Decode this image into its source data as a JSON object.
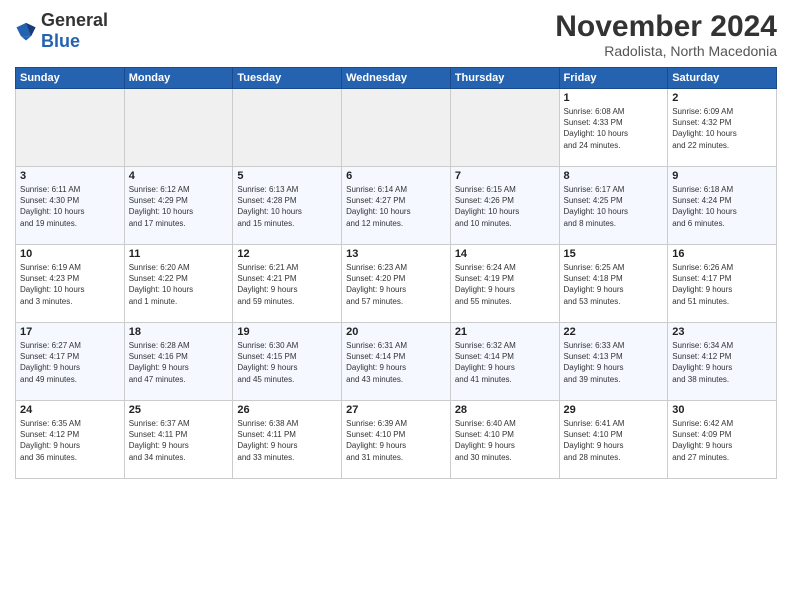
{
  "logo": {
    "general": "General",
    "blue": "Blue"
  },
  "title": "November 2024",
  "subtitle": "Radolista, North Macedonia",
  "headers": [
    "Sunday",
    "Monday",
    "Tuesday",
    "Wednesday",
    "Thursday",
    "Friday",
    "Saturday"
  ],
  "weeks": [
    [
      {
        "day": "",
        "info": ""
      },
      {
        "day": "",
        "info": ""
      },
      {
        "day": "",
        "info": ""
      },
      {
        "day": "",
        "info": ""
      },
      {
        "day": "",
        "info": ""
      },
      {
        "day": "1",
        "info": "Sunrise: 6:08 AM\nSunset: 4:33 PM\nDaylight: 10 hours\nand 24 minutes."
      },
      {
        "day": "2",
        "info": "Sunrise: 6:09 AM\nSunset: 4:32 PM\nDaylight: 10 hours\nand 22 minutes."
      }
    ],
    [
      {
        "day": "3",
        "info": "Sunrise: 6:11 AM\nSunset: 4:30 PM\nDaylight: 10 hours\nand 19 minutes."
      },
      {
        "day": "4",
        "info": "Sunrise: 6:12 AM\nSunset: 4:29 PM\nDaylight: 10 hours\nand 17 minutes."
      },
      {
        "day": "5",
        "info": "Sunrise: 6:13 AM\nSunset: 4:28 PM\nDaylight: 10 hours\nand 15 minutes."
      },
      {
        "day": "6",
        "info": "Sunrise: 6:14 AM\nSunset: 4:27 PM\nDaylight: 10 hours\nand 12 minutes."
      },
      {
        "day": "7",
        "info": "Sunrise: 6:15 AM\nSunset: 4:26 PM\nDaylight: 10 hours\nand 10 minutes."
      },
      {
        "day": "8",
        "info": "Sunrise: 6:17 AM\nSunset: 4:25 PM\nDaylight: 10 hours\nand 8 minutes."
      },
      {
        "day": "9",
        "info": "Sunrise: 6:18 AM\nSunset: 4:24 PM\nDaylight: 10 hours\nand 6 minutes."
      }
    ],
    [
      {
        "day": "10",
        "info": "Sunrise: 6:19 AM\nSunset: 4:23 PM\nDaylight: 10 hours\nand 3 minutes."
      },
      {
        "day": "11",
        "info": "Sunrise: 6:20 AM\nSunset: 4:22 PM\nDaylight: 10 hours\nand 1 minute."
      },
      {
        "day": "12",
        "info": "Sunrise: 6:21 AM\nSunset: 4:21 PM\nDaylight: 9 hours\nand 59 minutes."
      },
      {
        "day": "13",
        "info": "Sunrise: 6:23 AM\nSunset: 4:20 PM\nDaylight: 9 hours\nand 57 minutes."
      },
      {
        "day": "14",
        "info": "Sunrise: 6:24 AM\nSunset: 4:19 PM\nDaylight: 9 hours\nand 55 minutes."
      },
      {
        "day": "15",
        "info": "Sunrise: 6:25 AM\nSunset: 4:18 PM\nDaylight: 9 hours\nand 53 minutes."
      },
      {
        "day": "16",
        "info": "Sunrise: 6:26 AM\nSunset: 4:17 PM\nDaylight: 9 hours\nand 51 minutes."
      }
    ],
    [
      {
        "day": "17",
        "info": "Sunrise: 6:27 AM\nSunset: 4:17 PM\nDaylight: 9 hours\nand 49 minutes."
      },
      {
        "day": "18",
        "info": "Sunrise: 6:28 AM\nSunset: 4:16 PM\nDaylight: 9 hours\nand 47 minutes."
      },
      {
        "day": "19",
        "info": "Sunrise: 6:30 AM\nSunset: 4:15 PM\nDaylight: 9 hours\nand 45 minutes."
      },
      {
        "day": "20",
        "info": "Sunrise: 6:31 AM\nSunset: 4:14 PM\nDaylight: 9 hours\nand 43 minutes."
      },
      {
        "day": "21",
        "info": "Sunrise: 6:32 AM\nSunset: 4:14 PM\nDaylight: 9 hours\nand 41 minutes."
      },
      {
        "day": "22",
        "info": "Sunrise: 6:33 AM\nSunset: 4:13 PM\nDaylight: 9 hours\nand 39 minutes."
      },
      {
        "day": "23",
        "info": "Sunrise: 6:34 AM\nSunset: 4:12 PM\nDaylight: 9 hours\nand 38 minutes."
      }
    ],
    [
      {
        "day": "24",
        "info": "Sunrise: 6:35 AM\nSunset: 4:12 PM\nDaylight: 9 hours\nand 36 minutes."
      },
      {
        "day": "25",
        "info": "Sunrise: 6:37 AM\nSunset: 4:11 PM\nDaylight: 9 hours\nand 34 minutes."
      },
      {
        "day": "26",
        "info": "Sunrise: 6:38 AM\nSunset: 4:11 PM\nDaylight: 9 hours\nand 33 minutes."
      },
      {
        "day": "27",
        "info": "Sunrise: 6:39 AM\nSunset: 4:10 PM\nDaylight: 9 hours\nand 31 minutes."
      },
      {
        "day": "28",
        "info": "Sunrise: 6:40 AM\nSunset: 4:10 PM\nDaylight: 9 hours\nand 30 minutes."
      },
      {
        "day": "29",
        "info": "Sunrise: 6:41 AM\nSunset: 4:10 PM\nDaylight: 9 hours\nand 28 minutes."
      },
      {
        "day": "30",
        "info": "Sunrise: 6:42 AM\nSunset: 4:09 PM\nDaylight: 9 hours\nand 27 minutes."
      }
    ]
  ]
}
